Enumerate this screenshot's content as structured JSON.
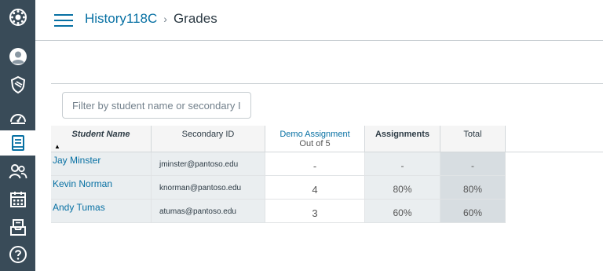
{
  "nav": {
    "items": [
      "logo",
      "account",
      "admin",
      "dashboard",
      "courses",
      "groups",
      "calendar",
      "inbox",
      "help"
    ]
  },
  "header": {
    "course": "History118C",
    "separator": "›",
    "page": "Grades"
  },
  "filter": {
    "placeholder": "Filter by student name or secondary ID"
  },
  "grid": {
    "columns": {
      "student_name": "Student Name",
      "secondary_id": "Secondary ID",
      "demo_assignment": "Demo Assignment",
      "demo_points": "Out of 5",
      "assignments": "Assignments",
      "total": "Total"
    },
    "sort_indicator": "▲",
    "rows": [
      {
        "name": "Jay Minster",
        "secondary_id": "jminster@pantoso.edu",
        "demo": "-",
        "assignments": "-",
        "total": "-"
      },
      {
        "name": "Kevin Norman",
        "secondary_id": "knorman@pantoso.edu",
        "demo": "4",
        "assignments": "80%",
        "total": "80%"
      },
      {
        "name": "Andy Tumas",
        "secondary_id": "atumas@pantoso.edu",
        "demo": "3",
        "assignments": "60%",
        "total": "60%"
      }
    ]
  },
  "colors": {
    "nav_bg": "#394b58",
    "link": "#0770a3",
    "active_nav": "#ffffff"
  }
}
